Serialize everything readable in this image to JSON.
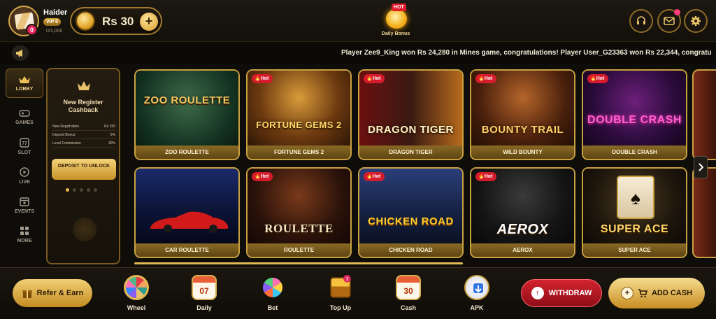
{
  "user": {
    "name": "Haider",
    "vip": "VIP 0",
    "vip_progress": "0/1,000",
    "avatar_badge": "0"
  },
  "balance": {
    "amount": "Rs 30"
  },
  "daily_bonus": {
    "hot": "HOT",
    "label": "Daily Bonus"
  },
  "ticker": {
    "text": "Player Zee9_King won Rs 24,280 in Mines game, congratulations! Player User_G23363 won Rs 22,344, congratu"
  },
  "sidebar": {
    "items": [
      {
        "label": "LOBBY",
        "icon": "crown-icon",
        "active": true
      },
      {
        "label": "GAMES",
        "icon": "gamepad-icon"
      },
      {
        "label": "SLOT",
        "icon": "slot-icon"
      },
      {
        "label": "LIVE",
        "icon": "play-icon"
      },
      {
        "label": "EVENTS",
        "icon": "calendar-icon"
      },
      {
        "label": "MORE",
        "icon": "grid-icon"
      }
    ]
  },
  "promo": {
    "title": "New Register Cashback",
    "rows": [
      {
        "label": "New Registration",
        "value": "Rs 150"
      },
      {
        "label": "Deposit Bonus",
        "value": "5%"
      },
      {
        "label": "Level Commission",
        "value": "30%"
      }
    ],
    "button": "DEPOSIT TO UNLOCK"
  },
  "games": [
    {
      "name": "ZOO ROULETTE",
      "logo": "ZOO ROULETTE",
      "hot": false
    },
    {
      "name": "FORTUNE GEMS 2",
      "logo": "FORTUNE GEMS 2",
      "hot": true
    },
    {
      "name": "DRAGON TIGER",
      "logo": "DRAGON TIGER",
      "hot": true
    },
    {
      "name": "WILD BOUNTY",
      "logo": "BOUNTY TRAIL",
      "hot": true
    },
    {
      "name": "DOUBLE CRASH",
      "logo": "DOUBLE CRASH",
      "hot": true
    },
    {
      "name": "CAR ROULETTE",
      "logo": "",
      "hot": false
    },
    {
      "name": "ROULETTE",
      "logo": "ROULETTE",
      "hot": true
    },
    {
      "name": "CHICKEN ROAD",
      "logo": "CHICKEN ROAD",
      "hot": true
    },
    {
      "name": "AEROX",
      "logo": "AEROX",
      "hot": true
    },
    {
      "name": "SUPER ACE",
      "logo": "SUPER ACE",
      "hot": false
    }
  ],
  "hot_label": "Hot",
  "bottom": {
    "refer": "Refer & Earn",
    "nav": [
      {
        "label": "Wheel",
        "icon": "wheel-icon"
      },
      {
        "label": "Daily",
        "icon": "calendar-icon",
        "value": "07"
      },
      {
        "label": "Bet",
        "icon": "spinner-icon"
      },
      {
        "label": "Top Up",
        "icon": "treasure-chest-icon",
        "badge": "1"
      },
      {
        "label": "Cash",
        "icon": "calendar-icon",
        "value": "30"
      },
      {
        "label": "APK",
        "icon": "download-icon"
      }
    ],
    "withdraw": "WITHDRAW",
    "add_cash": "ADD CASH"
  },
  "colors": {
    "gold": "#c9a13f",
    "accent_red": "#d3242f",
    "background": "#0f0d0a"
  }
}
